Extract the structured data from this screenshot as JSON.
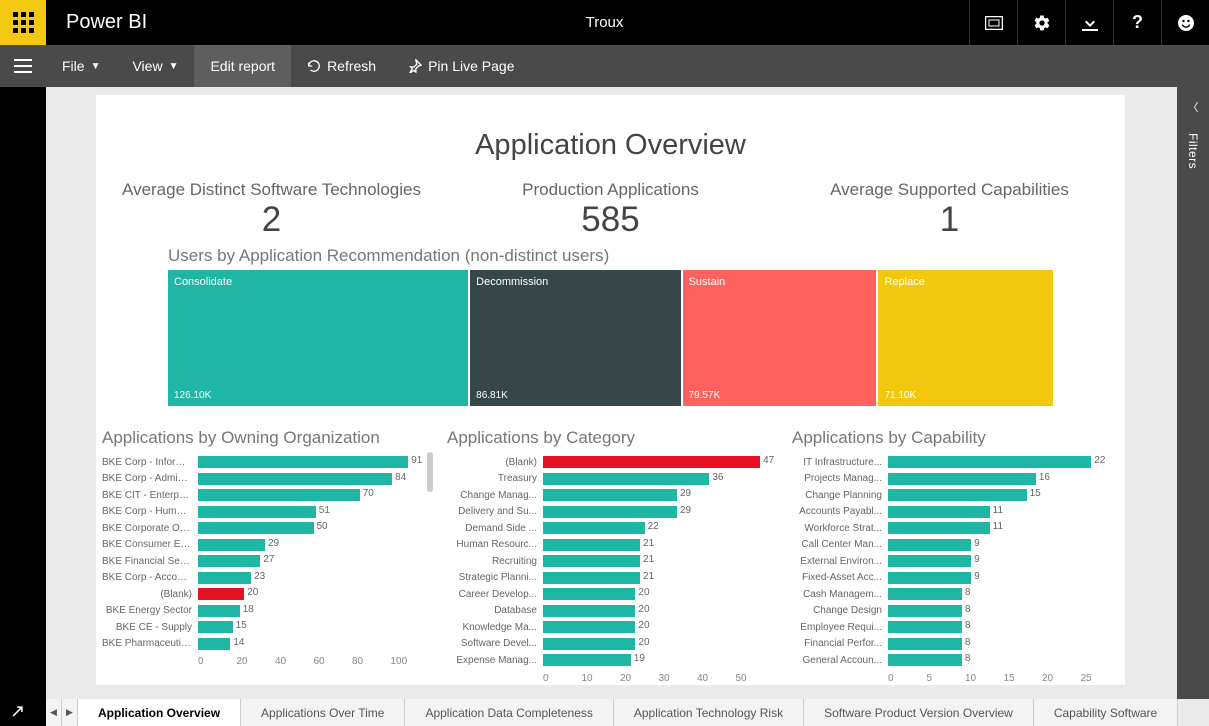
{
  "header": {
    "app_name": "Power BI",
    "workspace": "Troux",
    "icons": [
      "fullscreen",
      "settings",
      "download",
      "help",
      "feedback"
    ]
  },
  "toolbar": {
    "file": "File",
    "view": "View",
    "edit": "Edit report",
    "refresh": "Refresh",
    "pin": "Pin Live Page"
  },
  "filters_label": "Filters",
  "report": {
    "title": "Application Overview",
    "kpis": [
      {
        "label": "Average Distinct Software Technologies",
        "value": "2"
      },
      {
        "label": "Production Applications",
        "value": "585"
      },
      {
        "label": "Average Supported Capabilities",
        "value": "1"
      }
    ],
    "treemap": {
      "title": "Users by Application Recommendation (non-distinct users)",
      "cells": [
        {
          "label": "Consolidate",
          "value": "126.10K",
          "num": 126.1,
          "color": "#1fb6a6"
        },
        {
          "label": "Decommission",
          "value": "86.81K",
          "num": 86.81,
          "color": "#374649"
        },
        {
          "label": "Sustain",
          "value": "79.57K",
          "num": 79.57,
          "color": "#fd625e"
        },
        {
          "label": "Replace",
          "value": "71.10K",
          "num": 71.1,
          "color": "#f2c80f"
        }
      ]
    }
  },
  "chart_data": [
    {
      "type": "bar",
      "title": "Applications by Owning Organization",
      "orientation": "horizontal",
      "xlim": [
        0,
        100
      ],
      "xticks": [
        0,
        20,
        40,
        60,
        80,
        100
      ],
      "categories": [
        "BKE Corp - Informa...",
        "BKE Corp - Adminis...",
        "BKE CIT - Enterprise...",
        "BKE Corp - Human ...",
        "BKE Corporate Ope...",
        "BKE Consumer Elec...",
        "BKE Financial Servic...",
        "BKE Corp - Account...",
        "(Blank)",
        "BKE Energy Sector",
        "BKE CE - Supply",
        "BKE Pharmaceuticals"
      ],
      "values": [
        91,
        84,
        70,
        51,
        50,
        29,
        27,
        23,
        20,
        18,
        15,
        14
      ],
      "highlight_idx": 8
    },
    {
      "type": "bar",
      "title": "Applications by Category",
      "orientation": "horizontal",
      "xlim": [
        0,
        50
      ],
      "xticks": [
        0,
        10,
        20,
        30,
        40,
        50
      ],
      "categories": [
        "(Blank)",
        "Treasury",
        "Change Manag...",
        "Delivery and Su...",
        "Demand Side ...",
        "Human Resourc...",
        "Recruiting",
        "Strategic Planni...",
        "Career Develop...",
        "Database",
        "Knowledge Ma...",
        "Software Devel...",
        "Expense Manag..."
      ],
      "values": [
        47,
        36,
        29,
        29,
        22,
        21,
        21,
        21,
        20,
        20,
        20,
        20,
        19
      ],
      "highlight_idx": 0
    },
    {
      "type": "bar",
      "title": "Applications by Capability",
      "orientation": "horizontal",
      "xlim": [
        0,
        25
      ],
      "xticks": [
        0,
        5,
        10,
        15,
        20,
        25
      ],
      "categories": [
        "IT Infrastructure...",
        "Projects Manag...",
        "Change Planning",
        "Accounts Payabl...",
        "Workforce Strat...",
        "Call Center Man...",
        "External Environ...",
        "Fixed-Asset Acc...",
        "Cash Managem...",
        "Change Design",
        "Employee Requi...",
        "Financial Perfor...",
        "General Accoun..."
      ],
      "values": [
        22,
        16,
        15,
        11,
        11,
        9,
        9,
        9,
        8,
        8,
        8,
        8,
        8
      ]
    }
  ],
  "tabs": {
    "items": [
      "Application Overview",
      "Applications Over Time",
      "Application Data Completeness",
      "Application Technology Risk",
      "Software Product Version Overview",
      "Capability Software"
    ],
    "active": 0
  }
}
